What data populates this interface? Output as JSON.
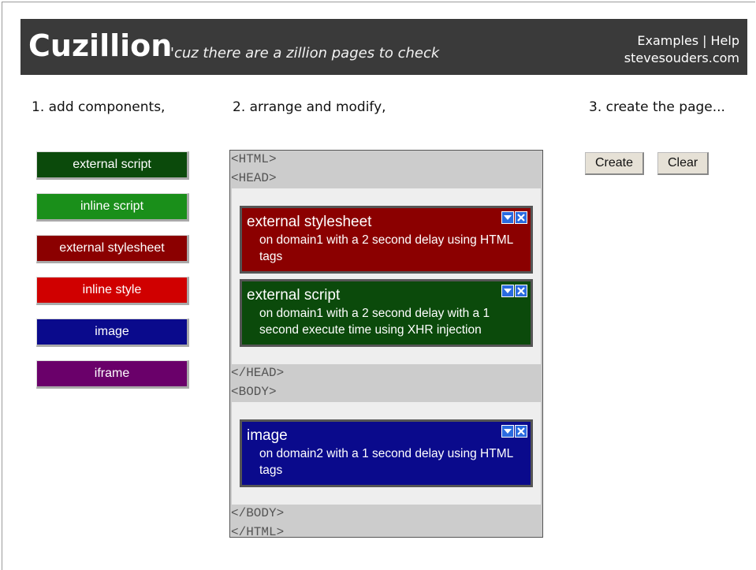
{
  "header": {
    "logo": "Cuzillion",
    "tagline": "'cuz there are a zillion pages to check",
    "links": {
      "examples": "Examples",
      "separator": "|",
      "help": "Help"
    },
    "site": "stevesouders.com"
  },
  "steps": {
    "add": "1. add components,",
    "arrange": "2. arrange and modify,",
    "create": "3. create the page..."
  },
  "palette": [
    {
      "label": "external script",
      "color": "#0b4a0b"
    },
    {
      "label": "inline script",
      "color": "#1a8f1a"
    },
    {
      "label": "external stylesheet",
      "color": "#8b0000"
    },
    {
      "label": "inline style",
      "color": "#d00000"
    },
    {
      "label": "image",
      "color": "#0a0a8c"
    },
    {
      "label": "iframe",
      "color": "#6a006a"
    }
  ],
  "page": {
    "tags": {
      "html_open": "<HTML>",
      "head_open": "<HEAD>",
      "head_close": "</HEAD>",
      "body_open": "<BODY>",
      "body_close": "</BODY>",
      "html_close": "</HTML>"
    },
    "head_components": [
      {
        "title": "external stylesheet",
        "desc": "on domain1 with a 2 second delay using HTML tags",
        "color": "#8b0000"
      },
      {
        "title": "external script",
        "desc": "on domain1 with a 2 second delay with a 1 second execute time using XHR injection",
        "color": "#0b4a0b"
      }
    ],
    "body_components": [
      {
        "title": "image",
        "desc": "on domain2 with a 1 second delay using HTML tags",
        "color": "#0a0a8c"
      }
    ]
  },
  "actions": {
    "create": "Create",
    "clear": "Clear"
  },
  "icons": {
    "dropdown": "chevron-down-icon",
    "remove": "close-icon"
  }
}
